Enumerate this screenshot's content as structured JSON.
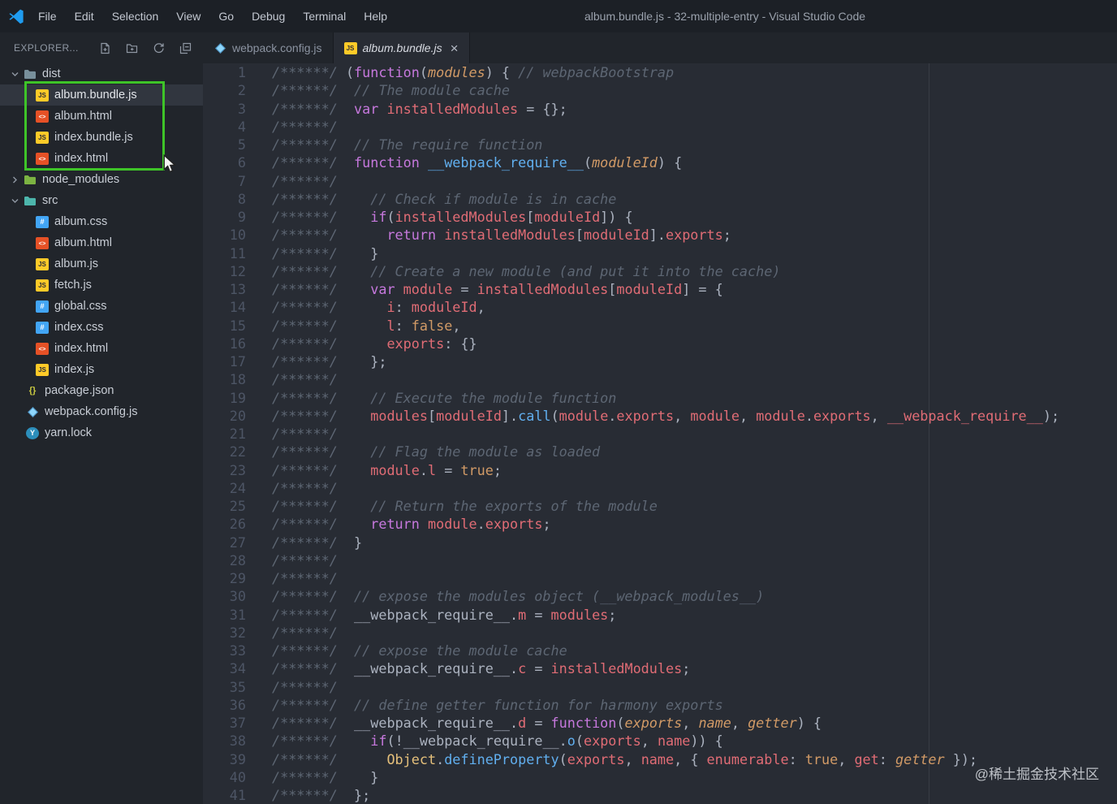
{
  "window": {
    "title": "album.bundle.js - 32-multiple-entry - Visual Studio Code"
  },
  "menu": {
    "items": [
      "File",
      "Edit",
      "Selection",
      "View",
      "Go",
      "Debug",
      "Terminal",
      "Help"
    ]
  },
  "explorer": {
    "title": "EXPLORER...",
    "actions": [
      "new-file-icon",
      "new-folder-icon",
      "refresh-icon",
      "collapse-all-icon"
    ],
    "tree": [
      {
        "label": "dist",
        "kind": "folder",
        "icon": "folder",
        "color": "#78909c",
        "depth": 0,
        "expanded": true
      },
      {
        "label": "album.bundle.js",
        "kind": "file",
        "icon": "js",
        "depth": 1,
        "selected": true
      },
      {
        "label": "album.html",
        "kind": "file",
        "icon": "html",
        "depth": 1
      },
      {
        "label": "index.bundle.js",
        "kind": "file",
        "icon": "js",
        "depth": 1
      },
      {
        "label": "index.html",
        "kind": "file",
        "icon": "html",
        "depth": 1
      },
      {
        "label": "node_modules",
        "kind": "folder",
        "icon": "folder",
        "color": "#7cb342",
        "depth": 0,
        "expanded": false
      },
      {
        "label": "src",
        "kind": "folder",
        "icon": "folder",
        "color": "#4db6ac",
        "depth": 0,
        "expanded": true
      },
      {
        "label": "album.css",
        "kind": "file",
        "icon": "css",
        "depth": 1
      },
      {
        "label": "album.html",
        "kind": "file",
        "icon": "html",
        "depth": 1
      },
      {
        "label": "album.js",
        "kind": "file",
        "icon": "js",
        "depth": 1
      },
      {
        "label": "fetch.js",
        "kind": "file",
        "icon": "js",
        "depth": 1
      },
      {
        "label": "global.css",
        "kind": "file",
        "icon": "css",
        "depth": 1
      },
      {
        "label": "index.css",
        "kind": "file",
        "icon": "css",
        "depth": 1
      },
      {
        "label": "index.html",
        "kind": "file",
        "icon": "html",
        "depth": 1
      },
      {
        "label": "index.js",
        "kind": "file",
        "icon": "js",
        "depth": 1
      },
      {
        "label": "package.json",
        "kind": "file",
        "icon": "json",
        "depth": 0
      },
      {
        "label": "webpack.config.js",
        "kind": "file",
        "icon": "webpack",
        "depth": 0
      },
      {
        "label": "yarn.lock",
        "kind": "file",
        "icon": "yarn",
        "depth": 0
      }
    ]
  },
  "tabs": [
    {
      "label": "webpack.config.js",
      "icon": "webpack",
      "active": false
    },
    {
      "label": "album.bundle.js",
      "icon": "js",
      "active": true
    }
  ],
  "ui": {
    "close_glyph": "×"
  },
  "icon_glyphs": {
    "js": "JS",
    "html": "<>",
    "css": "#",
    "json": "{}",
    "yarn": "Y"
  },
  "colors": {
    "keyword": "#c678dd",
    "variable": "#e06c75",
    "function": "#61afef",
    "constant": "#d19a66",
    "class": "#e5c07b",
    "comment": "#5d6673",
    "default": "#abb2bf",
    "highlight_green": "#3ec428",
    "editor_bg": "#282c34",
    "sidebar_bg": "#21252b"
  },
  "watermark": "@稀土掘金技术社区",
  "editor": {
    "lines": [
      {
        "n": 1,
        "t": [
          [
            "c",
            "/******/ "
          ],
          [
            "p",
            "("
          ],
          [
            "k",
            "function"
          ],
          [
            "p",
            "("
          ],
          [
            "pi",
            "modules"
          ],
          [
            "p",
            ") { "
          ],
          [
            "c",
            "// webpackBootstrap"
          ]
        ]
      },
      {
        "n": 2,
        "t": [
          [
            "c",
            "/******/  // The module cache"
          ]
        ]
      },
      {
        "n": 3,
        "t": [
          [
            "c",
            "/******/  "
          ],
          [
            "k",
            "var "
          ],
          [
            "v",
            "installedModules"
          ],
          [
            "p",
            " = {};"
          ]
        ]
      },
      {
        "n": 4,
        "t": [
          [
            "c",
            "/******/"
          ]
        ]
      },
      {
        "n": 5,
        "t": [
          [
            "c",
            "/******/  // The require function"
          ]
        ]
      },
      {
        "n": 6,
        "t": [
          [
            "c",
            "/******/  "
          ],
          [
            "k",
            "function "
          ],
          [
            "f",
            "__webpack_require__"
          ],
          [
            "p",
            "("
          ],
          [
            "pi",
            "moduleId"
          ],
          [
            "p",
            ") {"
          ]
        ]
      },
      {
        "n": 7,
        "t": [
          [
            "c",
            "/******/"
          ]
        ]
      },
      {
        "n": 8,
        "t": [
          [
            "c",
            "/******/    // Check if module is in cache"
          ]
        ]
      },
      {
        "n": 9,
        "t": [
          [
            "c",
            "/******/    "
          ],
          [
            "k",
            "if"
          ],
          [
            "p",
            "("
          ],
          [
            "v",
            "installedModules"
          ],
          [
            "p",
            "["
          ],
          [
            "v",
            "moduleId"
          ],
          [
            "p",
            "]) {"
          ]
        ]
      },
      {
        "n": 10,
        "t": [
          [
            "c",
            "/******/      "
          ],
          [
            "k",
            "return "
          ],
          [
            "v",
            "installedModules"
          ],
          [
            "p",
            "["
          ],
          [
            "v",
            "moduleId"
          ],
          [
            "p",
            "]."
          ],
          [
            "v",
            "exports"
          ],
          [
            "p",
            ";"
          ]
        ]
      },
      {
        "n": 11,
        "t": [
          [
            "c",
            "/******/    "
          ],
          [
            "p",
            "}"
          ]
        ]
      },
      {
        "n": 12,
        "t": [
          [
            "c",
            "/******/    // Create a new module (and put it into the cache)"
          ]
        ]
      },
      {
        "n": 13,
        "t": [
          [
            "c",
            "/******/    "
          ],
          [
            "k",
            "var "
          ],
          [
            "v",
            "module"
          ],
          [
            "p",
            " = "
          ],
          [
            "v",
            "installedModules"
          ],
          [
            "p",
            "["
          ],
          [
            "v",
            "moduleId"
          ],
          [
            "p",
            "] = {"
          ]
        ]
      },
      {
        "n": 14,
        "t": [
          [
            "c",
            "/******/      "
          ],
          [
            "v",
            "i"
          ],
          [
            "p",
            ": "
          ],
          [
            "v",
            "moduleId"
          ],
          [
            "p",
            ","
          ]
        ]
      },
      {
        "n": 15,
        "t": [
          [
            "c",
            "/******/      "
          ],
          [
            "v",
            "l"
          ],
          [
            "p",
            ": "
          ],
          [
            "o",
            "false"
          ],
          [
            "p",
            ","
          ]
        ]
      },
      {
        "n": 16,
        "t": [
          [
            "c",
            "/******/      "
          ],
          [
            "v",
            "exports"
          ],
          [
            "p",
            ": {}"
          ]
        ]
      },
      {
        "n": 17,
        "t": [
          [
            "c",
            "/******/    "
          ],
          [
            "p",
            "};"
          ]
        ]
      },
      {
        "n": 18,
        "t": [
          [
            "c",
            "/******/"
          ]
        ]
      },
      {
        "n": 19,
        "t": [
          [
            "c",
            "/******/    // Execute the module function"
          ]
        ]
      },
      {
        "n": 20,
        "t": [
          [
            "c",
            "/******/    "
          ],
          [
            "v",
            "modules"
          ],
          [
            "p",
            "["
          ],
          [
            "v",
            "moduleId"
          ],
          [
            "p",
            "]."
          ],
          [
            "f",
            "call"
          ],
          [
            "p",
            "("
          ],
          [
            "v",
            "module"
          ],
          [
            "p",
            "."
          ],
          [
            "v",
            "exports"
          ],
          [
            "p",
            ", "
          ],
          [
            "v",
            "module"
          ],
          [
            "p",
            ", "
          ],
          [
            "v",
            "module"
          ],
          [
            "p",
            "."
          ],
          [
            "v",
            "exports"
          ],
          [
            "p",
            ", "
          ],
          [
            "v",
            "__webpack_require__"
          ],
          [
            "p",
            ");"
          ]
        ]
      },
      {
        "n": 21,
        "t": [
          [
            "c",
            "/******/"
          ]
        ]
      },
      {
        "n": 22,
        "t": [
          [
            "c",
            "/******/    // Flag the module as loaded"
          ]
        ]
      },
      {
        "n": 23,
        "t": [
          [
            "c",
            "/******/    "
          ],
          [
            "v",
            "module"
          ],
          [
            "p",
            "."
          ],
          [
            "v",
            "l"
          ],
          [
            "p",
            " = "
          ],
          [
            "o",
            "true"
          ],
          [
            "p",
            ";"
          ]
        ]
      },
      {
        "n": 24,
        "t": [
          [
            "c",
            "/******/"
          ]
        ]
      },
      {
        "n": 25,
        "t": [
          [
            "c",
            "/******/    // Return the exports of the module"
          ]
        ]
      },
      {
        "n": 26,
        "t": [
          [
            "c",
            "/******/    "
          ],
          [
            "k",
            "return "
          ],
          [
            "v",
            "module"
          ],
          [
            "p",
            "."
          ],
          [
            "v",
            "exports"
          ],
          [
            "p",
            ";"
          ]
        ]
      },
      {
        "n": 27,
        "t": [
          [
            "c",
            "/******/  "
          ],
          [
            "p",
            "}"
          ]
        ]
      },
      {
        "n": 28,
        "t": [
          [
            "c",
            "/******/"
          ]
        ]
      },
      {
        "n": 29,
        "t": [
          [
            "c",
            "/******/"
          ]
        ]
      },
      {
        "n": 30,
        "t": [
          [
            "c",
            "/******/  // expose the modules object (__webpack_modules__)"
          ]
        ]
      },
      {
        "n": 31,
        "t": [
          [
            "c",
            "/******/  "
          ],
          [
            "p",
            "__webpack_require__."
          ],
          [
            "v",
            "m"
          ],
          [
            "p",
            " = "
          ],
          [
            "v",
            "modules"
          ],
          [
            "p",
            ";"
          ]
        ]
      },
      {
        "n": 32,
        "t": [
          [
            "c",
            "/******/"
          ]
        ]
      },
      {
        "n": 33,
        "t": [
          [
            "c",
            "/******/  // expose the module cache"
          ]
        ]
      },
      {
        "n": 34,
        "t": [
          [
            "c",
            "/******/  "
          ],
          [
            "p",
            "__webpack_require__."
          ],
          [
            "v",
            "c"
          ],
          [
            "p",
            " = "
          ],
          [
            "v",
            "installedModules"
          ],
          [
            "p",
            ";"
          ]
        ]
      },
      {
        "n": 35,
        "t": [
          [
            "c",
            "/******/"
          ]
        ]
      },
      {
        "n": 36,
        "t": [
          [
            "c",
            "/******/  // define getter function for harmony exports"
          ]
        ]
      },
      {
        "n": 37,
        "t": [
          [
            "c",
            "/******/  "
          ],
          [
            "p",
            "__webpack_require__."
          ],
          [
            "v",
            "d"
          ],
          [
            "p",
            " = "
          ],
          [
            "k",
            "function"
          ],
          [
            "p",
            "("
          ],
          [
            "pi",
            "exports"
          ],
          [
            "p",
            ", "
          ],
          [
            "pi",
            "name"
          ],
          [
            "p",
            ", "
          ],
          [
            "pi",
            "getter"
          ],
          [
            "p",
            ") {"
          ]
        ]
      },
      {
        "n": 38,
        "t": [
          [
            "c",
            "/******/    "
          ],
          [
            "k",
            "if"
          ],
          [
            "p",
            "(!"
          ],
          [
            "p",
            "__webpack_require__."
          ],
          [
            "f",
            "o"
          ],
          [
            "p",
            "("
          ],
          [
            "v",
            "exports"
          ],
          [
            "p",
            ", "
          ],
          [
            "v",
            "name"
          ],
          [
            "p",
            ")) {"
          ]
        ]
      },
      {
        "n": 39,
        "t": [
          [
            "c",
            "/******/      "
          ],
          [
            "y",
            "Object"
          ],
          [
            "p",
            "."
          ],
          [
            "f",
            "defineProperty"
          ],
          [
            "p",
            "("
          ],
          [
            "v",
            "exports"
          ],
          [
            "p",
            ", "
          ],
          [
            "v",
            "name"
          ],
          [
            "p",
            ", { "
          ],
          [
            "v",
            "enumerable"
          ],
          [
            "p",
            ": "
          ],
          [
            "o",
            "true"
          ],
          [
            "p",
            ", "
          ],
          [
            "v",
            "get"
          ],
          [
            "p",
            ": "
          ],
          [
            "pi",
            "getter"
          ],
          [
            "p",
            " });"
          ]
        ]
      },
      {
        "n": 40,
        "t": [
          [
            "c",
            "/******/    "
          ],
          [
            "p",
            "}"
          ]
        ]
      },
      {
        "n": 41,
        "t": [
          [
            "c",
            "/******/  "
          ],
          [
            "p",
            "};"
          ]
        ]
      }
    ]
  }
}
